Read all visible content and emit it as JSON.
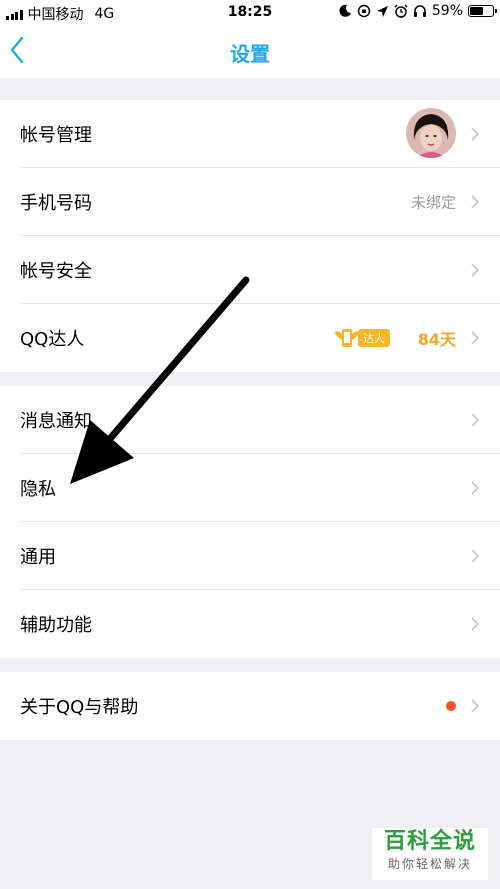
{
  "status_bar": {
    "carrier": "中国移动",
    "network": "4G",
    "time": "18:25",
    "battery": "59%",
    "battery_level": 0.59
  },
  "nav": {
    "title": "设置",
    "back_icon": "chevron-left-icon"
  },
  "groups": [
    {
      "rows": [
        {
          "label": "帐号管理",
          "accessory": "avatar"
        },
        {
          "label": "手机号码",
          "value": "未绑定"
        },
        {
          "label": "帐号安全"
        },
        {
          "label": "QQ达人",
          "badge": "达人",
          "days": "84天"
        }
      ]
    },
    {
      "rows": [
        {
          "label": "消息通知"
        },
        {
          "label": "隐私"
        },
        {
          "label": "通用"
        },
        {
          "label": "辅助功能"
        }
      ]
    },
    {
      "rows": [
        {
          "label": "关于QQ与帮助",
          "dot": true
        }
      ]
    }
  ],
  "watermark": {
    "title": "百科全说",
    "subtitle": "助你轻松解决"
  },
  "colors": {
    "accent": "#1fa9e5",
    "background": "#efeff4",
    "badge": "#f6b626",
    "dot": "#f4512f"
  }
}
